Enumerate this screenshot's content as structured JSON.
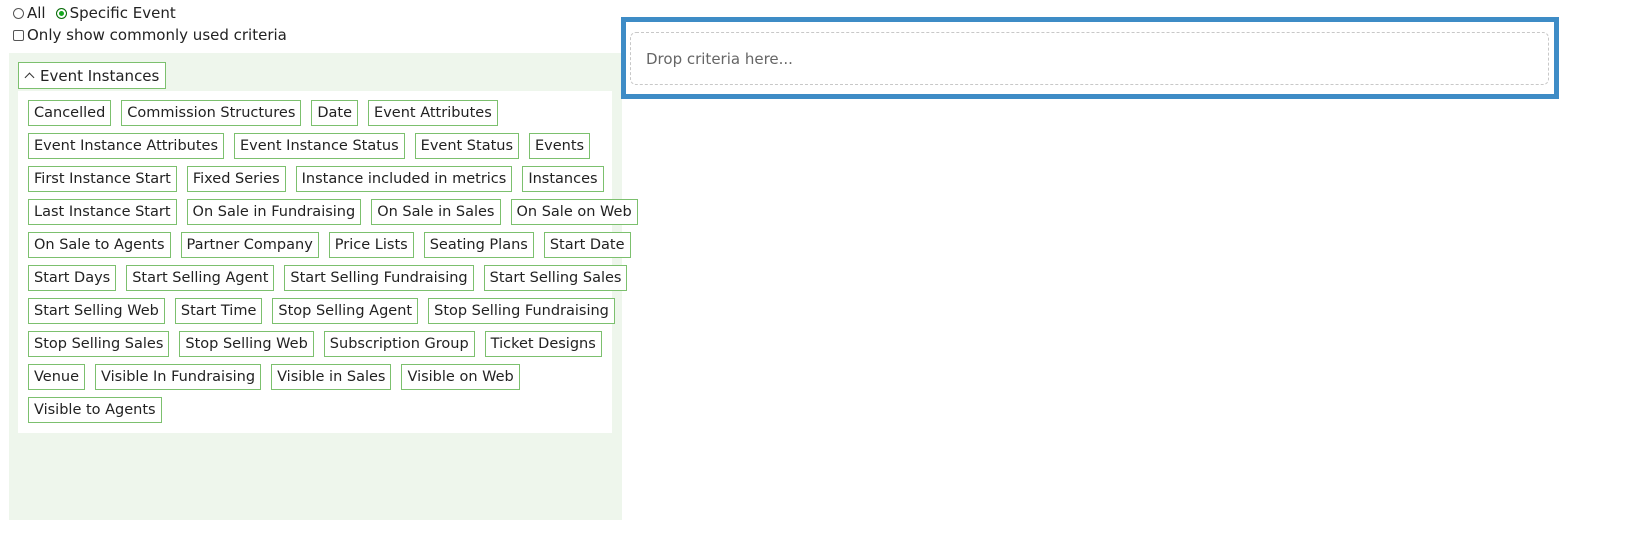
{
  "scope": {
    "options": [
      {
        "label": "All",
        "selected": false
      },
      {
        "label": "Specific Event",
        "selected": true
      }
    ]
  },
  "filter": {
    "common_only_label": "Only show commonly used criteria",
    "checked": false
  },
  "group": {
    "title": "Event Instances",
    "expanded": true
  },
  "criteria": [
    [
      "Cancelled",
      "Commission Structures",
      "Date",
      "Event Attributes"
    ],
    [
      "Event Instance Attributes",
      "Event Instance Status",
      "Event Status",
      "Events"
    ],
    [
      "First Instance Start",
      "Fixed Series",
      "Instance included in metrics",
      "Instances"
    ],
    [
      "Last Instance Start",
      "On Sale in Fundraising",
      "On Sale in Sales",
      "On Sale on Web"
    ],
    [
      "On Sale to Agents",
      "Partner Company",
      "Price Lists",
      "Seating Plans",
      "Start Date"
    ],
    [
      "Start Days",
      "Start Selling Agent",
      "Start Selling Fundraising",
      "Start Selling Sales"
    ],
    [
      "Start Selling Web",
      "Start Time",
      "Stop Selling Agent",
      "Stop Selling Fundraising"
    ],
    [
      "Stop Selling Sales",
      "Stop Selling Web",
      "Subscription Group",
      "Ticket Designs"
    ],
    [
      "Venue",
      "Visible In Fundraising",
      "Visible in Sales",
      "Visible on Web"
    ],
    [
      "Visible to Agents"
    ]
  ],
  "drop_zone": {
    "placeholder": "Drop criteria here..."
  },
  "colors": {
    "chip_border": "#7cc06e",
    "panel_bg": "#eef6ec",
    "drop_frame": "#3e8cc6",
    "radio_selected": "#14a81e"
  }
}
